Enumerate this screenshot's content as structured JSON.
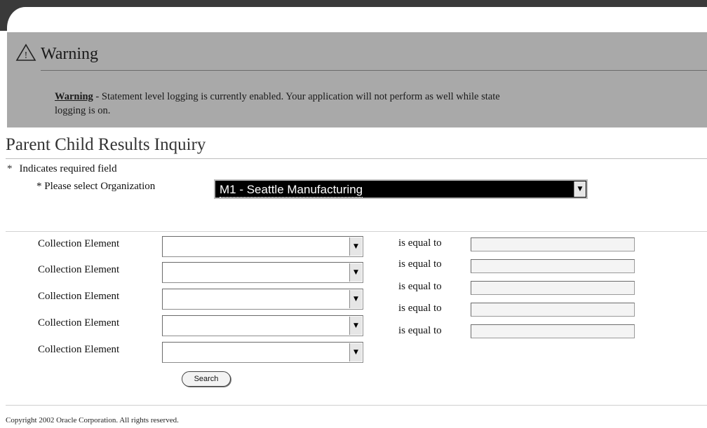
{
  "warning": {
    "title": "Warning",
    "label": "Warning",
    "message": "- Statement level logging is currently enabled. Your application will not perform as well while state",
    "message_line2": "logging is on."
  },
  "page": {
    "title": "Parent Child Results Inquiry",
    "required_legend_star": "*",
    "required_legend": "Indicates required field"
  },
  "organization": {
    "label": "* Please select Organization",
    "selected": "M1 - Seattle Manufacturing"
  },
  "criteria": {
    "element_label": "Collection Element",
    "operator_label": "is equal to",
    "rows": [
      {
        "element_label": "Collection Element",
        "operator_label": "is equal to",
        "element_value": "",
        "value": ""
      },
      {
        "element_label": "Collection Element",
        "operator_label": "is equal to",
        "element_value": "",
        "value": ""
      },
      {
        "element_label": "Collection Element",
        "operator_label": "is equal to",
        "element_value": "",
        "value": ""
      },
      {
        "element_label": "Collection Element",
        "operator_label": "is equal to",
        "element_value": "",
        "value": ""
      },
      {
        "element_label": "Collection Element",
        "operator_label": "is equal to",
        "element_value": "",
        "value": ""
      }
    ]
  },
  "search_label": "Search",
  "footer": {
    "copyright": "Copyright 2002 Oracle Corporation. All rights reserved."
  },
  "icons": {
    "warning": "warning-triangle-icon",
    "dropdown": "chevron-down-icon"
  }
}
